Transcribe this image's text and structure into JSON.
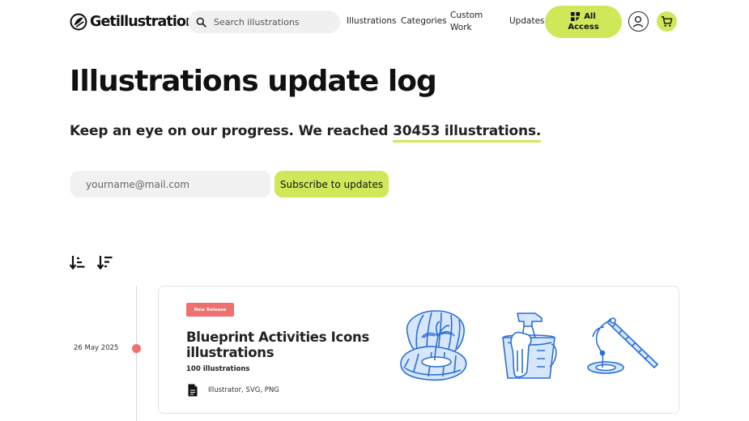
{
  "header": {
    "logo_text": "Getillustrations",
    "search_placeholder": "Search illustrations",
    "nav": {
      "illustrations": "Illustrations",
      "categories": "Categories",
      "custom_work": "Custom Work",
      "updates": "Updates"
    },
    "all_access_line1": "All",
    "all_access_line2": "Access"
  },
  "hero": {
    "title": "Illustrations update log",
    "subtitle_prefix": "Keep an eye on our progress. We reached ",
    "subtitle_highlight": "30453 illustrations."
  },
  "subscribe": {
    "email_placeholder": "yourname@mail.com",
    "button_label": "Subscribe to updates"
  },
  "timeline": [
    {
      "date": "26 May 2025",
      "badge": "New Release",
      "title": "Blueprint Activities Icons illustrations",
      "count": "100 illustrations",
      "formats": "Illustrator, SVG, PNG"
    }
  ],
  "colors": {
    "accent": "#cfe85a",
    "badge": "#f07070",
    "illustration_stroke": "#2b6fd6",
    "illustration_fill": "#d6e6fb"
  },
  "icons": {
    "logo": "logo-mark-icon",
    "search": "search-icon",
    "all_access": "grid-icon",
    "user": "user-icon",
    "cart": "cart-icon",
    "sort_asc": "sort-ascending-icon",
    "sort_desc": "sort-descending-icon",
    "file": "file-icon"
  }
}
